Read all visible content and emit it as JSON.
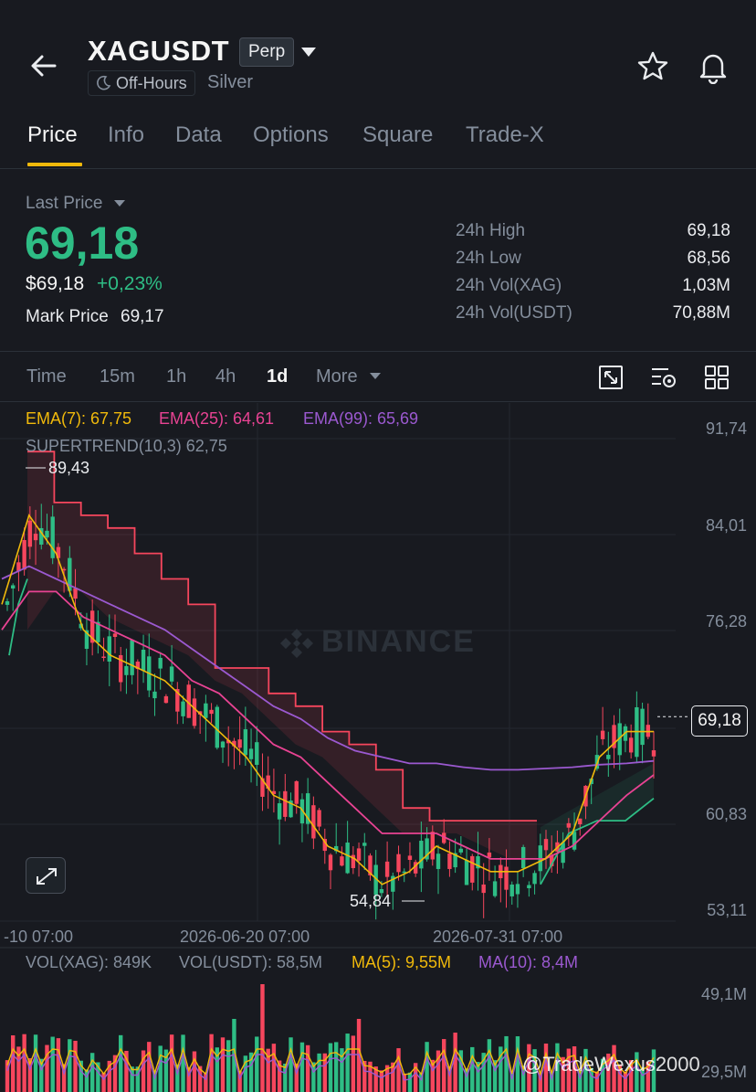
{
  "header": {
    "symbol": "XAGUSDT",
    "contract_badge": "Perp",
    "session_status": "Off-Hours",
    "asset_name": "Silver",
    "icons": [
      "back-arrow-icon",
      "caret-down-icon",
      "moon-icon",
      "star-icon",
      "bell-icon"
    ]
  },
  "tabs": [
    {
      "label": "Price",
      "active": true
    },
    {
      "label": "Info",
      "active": false
    },
    {
      "label": "Data",
      "active": false
    },
    {
      "label": "Options",
      "active": false
    },
    {
      "label": "Square",
      "active": false
    },
    {
      "label": "Trade-X",
      "active": false
    }
  ],
  "ticker": {
    "last_price_label": "Last Price",
    "last_price": "69,18",
    "usd_price": "$69,18",
    "change_pct": "+0,23%",
    "mark_price_label": "Mark Price",
    "mark_price": "69,17",
    "stats": [
      {
        "label": "24h High",
        "value": "69,18"
      },
      {
        "label": "24h Low",
        "value": "68,56"
      },
      {
        "label": "24h Vol(XAG)",
        "value": "1,03M"
      },
      {
        "label": "24h Vol(USDT)",
        "value": "70,88M"
      }
    ]
  },
  "intervals": {
    "items": [
      {
        "label": "Time",
        "active": false
      },
      {
        "label": "15m",
        "active": false
      },
      {
        "label": "1h",
        "active": false
      },
      {
        "label": "4h",
        "active": false
      },
      {
        "label": "1d",
        "active": true
      },
      {
        "label": "More",
        "active": false
      }
    ],
    "tools": [
      "fullscreen-chart-icon",
      "indicator-settings-icon",
      "layout-grid-icon"
    ]
  },
  "indicators": {
    "ema7": "EMA(7): 67,75",
    "ema25": "EMA(25): 64,61",
    "ema99": "EMA(99): 65,69",
    "supertrend": "SUPERTREND(10,3) 62,75",
    "volume": {
      "vol_xag": "VOL(XAG): 849K",
      "vol_usdt": "VOL(USDT): 58,5M",
      "ma5": "MA(5): 9,55M",
      "ma10": "MA(10): 8,4M"
    }
  },
  "colors": {
    "up": "#2ebd85",
    "down": "#f6465d",
    "ema7": "#f0b90b",
    "ema25": "#e84393",
    "ema99": "#9b59d0",
    "accent": "#f0b90b"
  },
  "watermark": "BINANCE",
  "credit": "@TradeWexus2000",
  "chart_data": {
    "type": "candlestick",
    "y_ticks": [
      "91,74",
      "84,01",
      "76,28",
      "69,18",
      "60,83",
      "53,11"
    ],
    "x_ticks": [
      "-10 07:00",
      "2026-06-20 07:00",
      "2026-07-31 07:00"
    ],
    "current_price": "69,18",
    "high_marker": "89,43",
    "low_marker": "54,84",
    "ylim": [
      53.11,
      91.74
    ],
    "ema7": [
      78,
      85,
      82,
      76,
      74,
      73,
      72,
      70,
      68,
      66,
      63,
      62,
      59,
      58,
      56,
      57,
      59,
      58,
      57,
      57,
      58,
      60,
      66,
      68,
      68
    ],
    "ema25": [
      76,
      79,
      79,
      77,
      76,
      75,
      74,
      72,
      71,
      69,
      67,
      66,
      64,
      62,
      60,
      60,
      60,
      59,
      58,
      58,
      58,
      59,
      61,
      63,
      64.6
    ],
    "ema99": [
      80,
      81,
      80,
      79,
      78,
      77,
      76,
      74.5,
      73,
      71.5,
      70,
      69,
      67.5,
      66.5,
      66,
      65.5,
      65.5,
      65.2,
      65,
      65,
      65.1,
      65.2,
      65.4,
      65.5,
      65.7
    ],
    "supertrend_upper": [
      90,
      86,
      85,
      84,
      82,
      80,
      78,
      73,
      73,
      71,
      70,
      68,
      67,
      65,
      62,
      61,
      61,
      61,
      61,
      61
    ],
    "supertrend_lower": [
      74,
      78,
      80
    ],
    "supertrend_lower_end": [
      56,
      60,
      61,
      61,
      62.75
    ],
    "volume_yticks": [
      "49,1M",
      "29,5M"
    ]
  }
}
